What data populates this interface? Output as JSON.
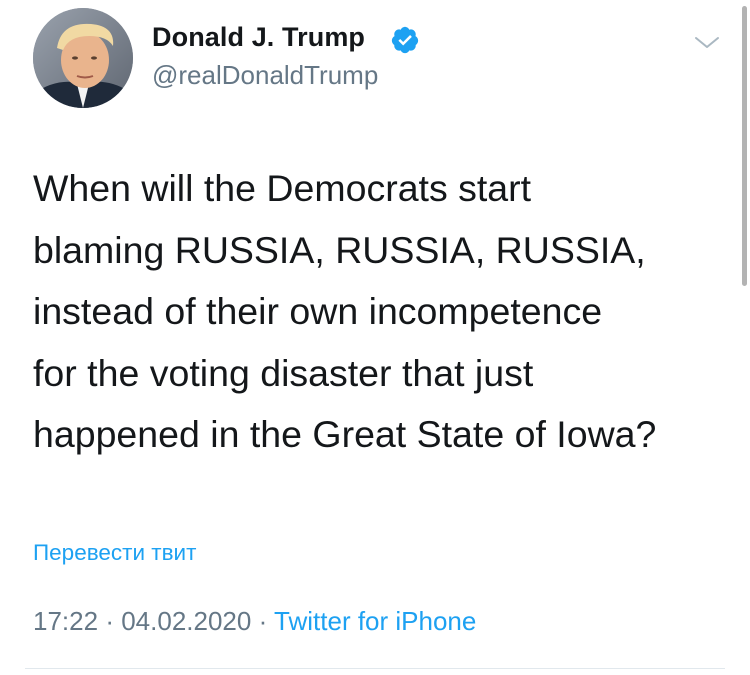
{
  "tweet": {
    "author": {
      "display_name": "Donald J. Trump",
      "handle": "@realDonaldTrump",
      "verified": true,
      "avatar_icon": "profile-photo"
    },
    "text_lines": [
      "When will the Democrats start",
      "blaming RUSSIA, RUSSIA, RUSSIA,",
      "instead of their own incompetence",
      "for the voting disaster that just",
      "happened in the Great State of Iowa?"
    ],
    "translate_label": "Перевести твит",
    "time": "17:22",
    "date": "04.02.2020",
    "separator": "·",
    "source": "Twitter for iPhone"
  },
  "colors": {
    "accent": "#1da1f2",
    "text_primary": "#14171a",
    "text_secondary": "#657786",
    "divider": "#e1e8ed"
  },
  "icons": {
    "verified": "verified-badge-icon",
    "more": "chevron-down-icon"
  }
}
